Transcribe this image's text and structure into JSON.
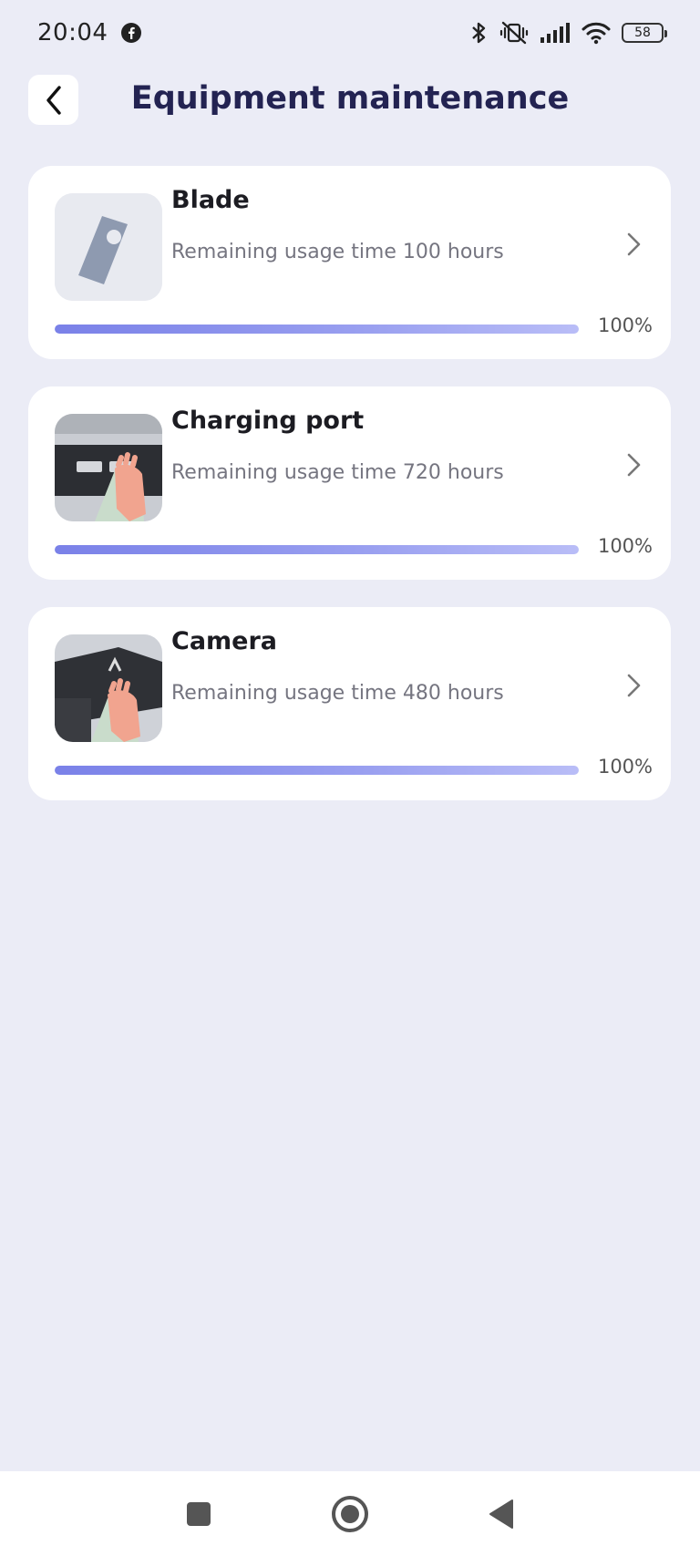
{
  "status_bar": {
    "time": "20:04",
    "battery": "58",
    "icons": [
      "facebook-icon",
      "bluetooth-icon",
      "vibrate-off-icon",
      "signal-icon",
      "wifi-icon",
      "battery-icon"
    ]
  },
  "header": {
    "title": "Equipment maintenance",
    "back_icon": "chevron-left-icon"
  },
  "items": [
    {
      "title": "Blade",
      "subtitle": "Remaining usage time 100 hours",
      "percent_label": "100%",
      "progress": 1.0,
      "image": "blade-image"
    },
    {
      "title": "Charging port",
      "subtitle": "Remaining usage time 720 hours",
      "percent_label": "100%",
      "progress": 1.0,
      "image": "charging-port-image"
    },
    {
      "title": "Camera",
      "subtitle": "Remaining usage time 480 hours",
      "percent_label": "100%",
      "progress": 1.0,
      "image": "camera-image"
    }
  ],
  "nav_bar": {
    "icons": [
      "recents-square-icon",
      "home-circle-icon",
      "back-triangle-icon"
    ]
  },
  "colors": {
    "background": "#ebecf6",
    "card": "#ffffff",
    "title": "#232352",
    "progress_start": "#7a81e8",
    "progress_end": "#b9bdf7"
  }
}
